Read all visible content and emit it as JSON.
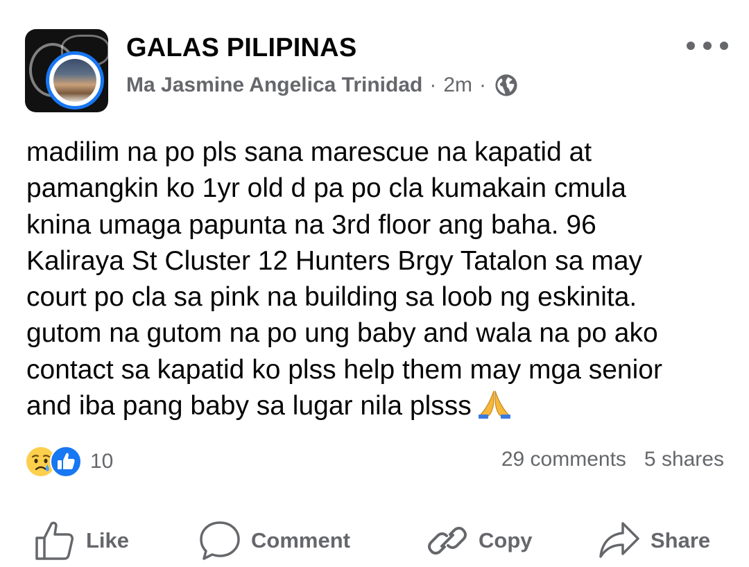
{
  "post": {
    "group_name": "GALAS PILIPINAS",
    "author": "Ma Jasmine Angelica Trinidad",
    "time": "2m",
    "separator": "·",
    "privacy_icon": "globe-icon",
    "body_lines": [
      "madilim na po pls sana marescue na kapatid at",
      "pamangkin ko 1yr old d pa po cla kumakain cmula",
      "knina umaga papunta na 3rd floor ang baha. 96",
      "Kaliraya St Cluster 12 Hunters Brgy Tatalon sa may",
      "court po cla sa pink na building sa loob ng eskinita.",
      "gutom na gutom na po ung baby and wala na po ako",
      "contact sa kapatid ko plss help them may mga senior",
      "and iba pang baby sa lugar nila plsss"
    ],
    "body_emoji_icon": "folded-hands-icon"
  },
  "engagement": {
    "reaction_icons": [
      "crying-face-icon",
      "like-icon"
    ],
    "reaction_count": "10",
    "comments": "29 comments",
    "shares": "5 shares"
  },
  "actions": {
    "like": "Like",
    "comment": "Comment",
    "copy": "Copy",
    "share": "Share"
  },
  "colors": {
    "accent": "#1877f2",
    "secondary_text": "#65676b",
    "primary_text": "#050505"
  }
}
